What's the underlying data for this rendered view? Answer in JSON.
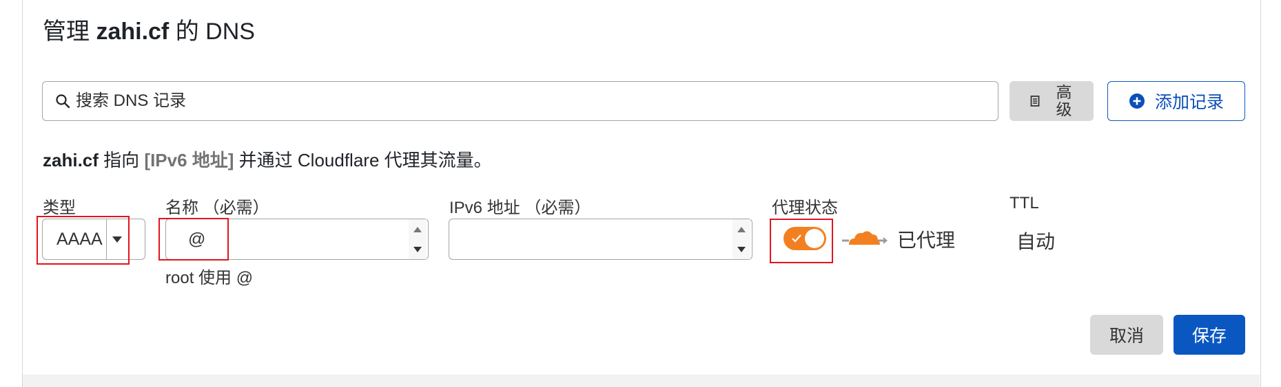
{
  "header": {
    "title_prefix": "管理",
    "domain": "zahi.cf",
    "title_suffix": "的 DNS"
  },
  "search": {
    "placeholder": "搜索 DNS 记录",
    "value": ""
  },
  "toolbar": {
    "advanced_label": "高级",
    "add_record_label": "添加记录"
  },
  "description": {
    "domain": "zahi.cf",
    "text1": "指向",
    "highlight": "[IPv6 地址]",
    "text2": "并通过 Cloudflare 代理其流量。"
  },
  "form": {
    "type_label": "类型",
    "type_value": "AAAA",
    "name_label": "名称 （必需）",
    "name_value": "@",
    "name_hint": "root 使用 @",
    "ipv6_label": "IPv6 地址 （必需）",
    "ipv6_value": "",
    "proxy_label": "代理状态",
    "proxy_enabled": true,
    "proxy_status_text": "已代理",
    "ttl_label": "TTL",
    "ttl_value": "自动"
  },
  "actions": {
    "cancel_label": "取消",
    "save_label": "保存"
  },
  "colors": {
    "accent_blue": "#0b57c2",
    "proxy_orange": "#f38020",
    "highlight_red": "#e0141e"
  }
}
